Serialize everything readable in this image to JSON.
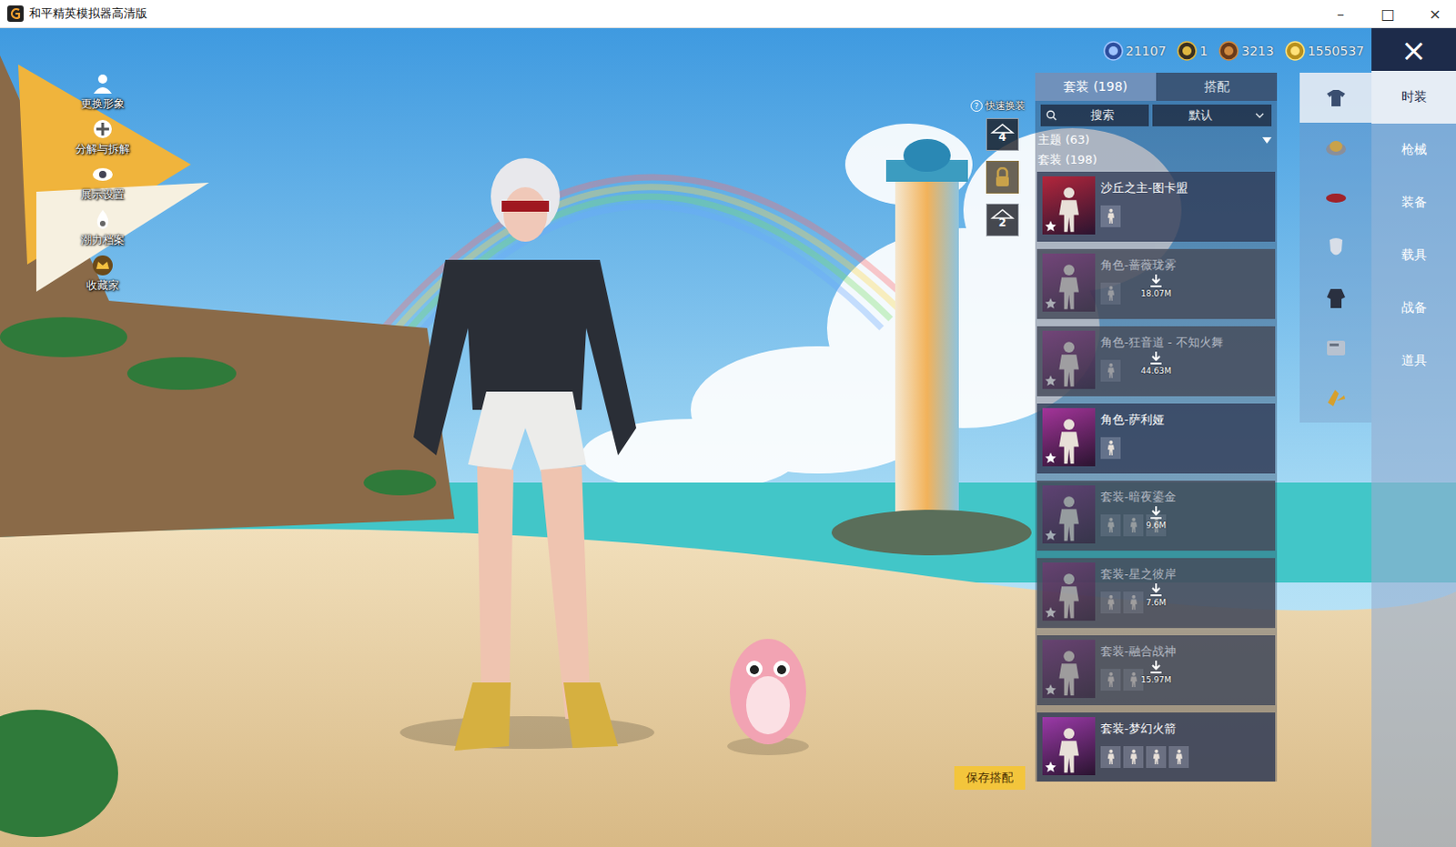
{
  "window": {
    "title": "和平精英模拟器高清版",
    "controls": [
      "–",
      "□",
      "×"
    ]
  },
  "leftMenu": [
    {
      "label": "更换形象",
      "kind": "avatar"
    },
    {
      "label": "分解与拆解",
      "kind": "decompose"
    },
    {
      "label": "展示设置",
      "kind": "display"
    },
    {
      "label": "潮力档案",
      "kind": "profile"
    },
    {
      "label": "收藏家",
      "kind": "collector"
    }
  ],
  "currencies": [
    {
      "value": "21107",
      "kind": "diamond"
    },
    {
      "value": "1",
      "kind": "token"
    },
    {
      "value": "3213",
      "kind": "badge"
    },
    {
      "value": "1550537",
      "kind": "coin"
    }
  ],
  "quickChange": {
    "label": "快速换装",
    "help": "?",
    "slots": [
      {
        "kind": "preset",
        "label": "4"
      },
      {
        "kind": "locked"
      },
      {
        "kind": "preset",
        "label": "2"
      }
    ]
  },
  "saveButton": "保存搭配",
  "tabs": [
    {
      "label": "套装 (198)",
      "selected": true
    },
    {
      "label": "搭配",
      "selected": false
    }
  ],
  "search": {
    "placeholder": "搜索"
  },
  "sort": {
    "value": "默认"
  },
  "filters": [
    {
      "label": "主题 (63)",
      "expandable": true
    },
    {
      "label": "套装 (198)",
      "expandable": false
    }
  ],
  "outfits": [
    {
      "name": "沙丘之主-图卡盟",
      "downloaded": true,
      "parts": 1,
      "color": "#b3263c"
    },
    {
      "name": "角色-蔷薇珑雾",
      "downloaded": false,
      "size": "18.07M",
      "parts": 1,
      "color": "#8e2f86"
    },
    {
      "name": "角色-狂音道 - 不知火舞",
      "downloaded": false,
      "size": "44.63M",
      "parts": 1,
      "color": "#8e2f86"
    },
    {
      "name": "角色-萨利娅",
      "downloaded": true,
      "parts": 1,
      "color": "#a4359a"
    },
    {
      "name": "套装-暗夜鎏金",
      "downloaded": false,
      "size": "9.6M",
      "parts": 3,
      "color": "#7a2f80"
    },
    {
      "name": "套装-星之彼岸",
      "downloaded": false,
      "size": "7.6M",
      "parts": 2,
      "color": "#8a2f7c"
    },
    {
      "name": "套装-融合战神",
      "downloaded": false,
      "size": "15.97M",
      "parts": 2,
      "color": "#7a2f80"
    },
    {
      "name": "套装-梦幻火箭",
      "downloaded": true,
      "parts": 4,
      "color": "#9b3aa8"
    }
  ],
  "categoryIcons": [
    {
      "kind": "outfit",
      "selected": true
    },
    {
      "kind": "headwear",
      "selected": false
    },
    {
      "kind": "face",
      "selected": false
    },
    {
      "kind": "mask",
      "selected": false
    },
    {
      "kind": "clothes",
      "selected": false
    },
    {
      "kind": "card",
      "selected": false
    },
    {
      "kind": "accessory",
      "selected": false
    }
  ],
  "categories": [
    {
      "label": "时装",
      "selected": true
    },
    {
      "label": "枪械",
      "selected": false
    },
    {
      "label": "装备",
      "selected": false
    },
    {
      "label": "载具",
      "selected": false
    },
    {
      "label": "战备",
      "selected": false
    },
    {
      "label": "道具",
      "selected": false
    }
  ],
  "close": "×"
}
